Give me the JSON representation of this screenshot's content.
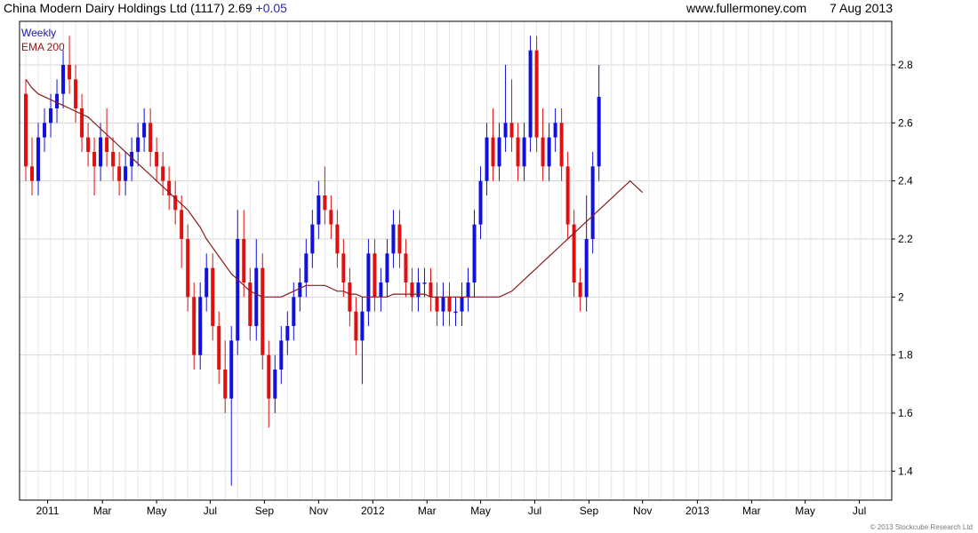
{
  "header": {
    "title": "China Modern Dairy Holdings Ltd (1117)",
    "price": "2.69",
    "change": "+0.05",
    "website": "www.fullermoney.com",
    "date": "7 Aug 2013"
  },
  "legend": {
    "period": "Weekly",
    "ema": "EMA 200"
  },
  "copyright": "© 2013 Stockcube Research Ltd",
  "colors": {
    "up": "#1010e0",
    "down": "#e01010",
    "ema": "#8b1a1a",
    "grid": "#d4d4d4",
    "period_text": "#1a1aaa"
  },
  "chart_data": {
    "type": "candlestick",
    "frequency": "weekly",
    "y_axis": {
      "min": 1.3,
      "max": 2.95,
      "ticks": [
        1.4,
        1.6,
        1.8,
        2,
        2.2,
        2.4,
        2.6,
        2.8
      ],
      "tick_labels": [
        "1.4",
        "1.6",
        "1.8",
        "2",
        "2.2",
        "2.4",
        "2.6",
        "2.8"
      ],
      "position": "right"
    },
    "x_axis": {
      "week_range": [
        -1,
        139
      ],
      "tick_labels": [
        "2011",
        "Mar",
        "May",
        "Jul",
        "Sep",
        "Nov",
        "2012",
        "Mar",
        "May",
        "Jul",
        "Sep",
        "Nov",
        "2013",
        "Mar",
        "May",
        "Jul"
      ],
      "tick_weeks": [
        3.5,
        12.3,
        21,
        29.6,
        38.3,
        47,
        55.7,
        64.4,
        73,
        81.7,
        90.4,
        99,
        107.8,
        116.5,
        125.1,
        133.8
      ]
    },
    "grid": true,
    "legend_position": "top-left",
    "candles": [
      [
        2.7,
        2.75,
        2.4,
        2.45
      ],
      [
        2.45,
        2.55,
        2.35,
        2.4
      ],
      [
        2.4,
        2.6,
        2.35,
        2.55
      ],
      [
        2.55,
        2.65,
        2.5,
        2.6
      ],
      [
        2.6,
        2.7,
        2.55,
        2.65
      ],
      [
        2.65,
        2.75,
        2.6,
        2.7
      ],
      [
        2.7,
        2.85,
        2.65,
        2.8
      ],
      [
        2.8,
        2.9,
        2.7,
        2.75
      ],
      [
        2.75,
        2.8,
        2.6,
        2.65
      ],
      [
        2.65,
        2.7,
        2.5,
        2.55
      ],
      [
        2.55,
        2.6,
        2.45,
        2.5
      ],
      [
        2.5,
        2.55,
        2.35,
        2.45
      ],
      [
        2.45,
        2.6,
        2.4,
        2.55
      ],
      [
        2.55,
        2.65,
        2.45,
        2.5
      ],
      [
        2.5,
        2.55,
        2.4,
        2.45
      ],
      [
        2.45,
        2.5,
        2.35,
        2.4
      ],
      [
        2.4,
        2.5,
        2.35,
        2.45
      ],
      [
        2.45,
        2.55,
        2.4,
        2.5
      ],
      [
        2.5,
        2.6,
        2.45,
        2.55
      ],
      [
        2.55,
        2.65,
        2.5,
        2.6
      ],
      [
        2.6,
        2.65,
        2.45,
        2.5
      ],
      [
        2.5,
        2.55,
        2.4,
        2.45
      ],
      [
        2.45,
        2.5,
        2.35,
        2.4
      ],
      [
        2.4,
        2.45,
        2.3,
        2.35
      ],
      [
        2.35,
        2.4,
        2.25,
        2.3
      ],
      [
        2.3,
        2.35,
        2.1,
        2.2
      ],
      [
        2.2,
        2.25,
        1.95,
        2.0
      ],
      [
        2.0,
        2.05,
        1.75,
        1.8
      ],
      [
        1.8,
        2.05,
        1.75,
        2.0
      ],
      [
        2.0,
        2.15,
        1.95,
        2.1
      ],
      [
        2.1,
        2.15,
        1.85,
        1.9
      ],
      [
        1.9,
        1.95,
        1.7,
        1.75
      ],
      [
        1.75,
        1.85,
        1.6,
        1.65
      ],
      [
        1.65,
        1.9,
        1.35,
        1.85
      ],
      [
        1.85,
        2.3,
        1.8,
        2.2
      ],
      [
        2.2,
        2.3,
        2.0,
        2.05
      ],
      [
        2.05,
        2.1,
        1.85,
        1.9
      ],
      [
        1.9,
        2.2,
        1.85,
        2.1
      ],
      [
        2.1,
        2.15,
        1.75,
        1.8
      ],
      [
        1.8,
        1.85,
        1.55,
        1.65
      ],
      [
        1.65,
        1.8,
        1.6,
        1.75
      ],
      [
        1.75,
        1.9,
        1.7,
        1.85
      ],
      [
        1.85,
        1.95,
        1.8,
        1.9
      ],
      [
        1.9,
        2.05,
        1.85,
        2.0
      ],
      [
        2.0,
        2.1,
        1.95,
        2.05
      ],
      [
        2.05,
        2.2,
        2.0,
        2.15
      ],
      [
        2.15,
        2.3,
        2.1,
        2.25
      ],
      [
        2.25,
        2.4,
        2.2,
        2.35
      ],
      [
        2.35,
        2.45,
        2.25,
        2.3
      ],
      [
        2.3,
        2.35,
        2.2,
        2.25
      ],
      [
        2.25,
        2.3,
        2.1,
        2.15
      ],
      [
        2.15,
        2.2,
        2.0,
        2.05
      ],
      [
        2.05,
        2.1,
        1.9,
        1.95
      ],
      [
        1.95,
        2.0,
        1.8,
        1.85
      ],
      [
        1.85,
        2.0,
        1.7,
        1.95
      ],
      [
        1.95,
        2.2,
        1.9,
        2.15
      ],
      [
        2.15,
        2.2,
        1.95,
        2.0
      ],
      [
        2.0,
        2.1,
        1.95,
        2.05
      ],
      [
        2.05,
        2.2,
        2.0,
        2.15
      ],
      [
        2.15,
        2.3,
        2.1,
        2.25
      ],
      [
        2.25,
        2.3,
        2.1,
        2.15
      ],
      [
        2.15,
        2.2,
        2.0,
        2.05
      ],
      [
        2.05,
        2.1,
        1.95,
        2.0
      ],
      [
        2.0,
        2.1,
        1.95,
        2.05
      ],
      [
        2.05,
        2.1,
        2.0,
        2.05
      ],
      [
        2.05,
        2.1,
        1.95,
        2.0
      ],
      [
        2.0,
        2.05,
        1.9,
        1.95
      ],
      [
        1.95,
        2.05,
        1.9,
        2.0
      ],
      [
        2.0,
        2.05,
        1.9,
        1.95
      ],
      [
        1.95,
        2.0,
        1.9,
        1.95
      ],
      [
        1.95,
        2.05,
        1.9,
        2.0
      ],
      [
        2.0,
        2.1,
        1.95,
        2.05
      ],
      [
        2.05,
        2.3,
        2.0,
        2.25
      ],
      [
        2.25,
        2.45,
        2.2,
        2.4
      ],
      [
        2.4,
        2.6,
        2.35,
        2.55
      ],
      [
        2.55,
        2.65,
        2.4,
        2.45
      ],
      [
        2.45,
        2.6,
        2.4,
        2.55
      ],
      [
        2.55,
        2.8,
        2.5,
        2.6
      ],
      [
        2.6,
        2.75,
        2.5,
        2.55
      ],
      [
        2.55,
        2.6,
        2.4,
        2.45
      ],
      [
        2.45,
        2.6,
        2.4,
        2.55
      ],
      [
        2.55,
        2.9,
        2.5,
        2.85
      ],
      [
        2.85,
        2.9,
        2.5,
        2.55
      ],
      [
        2.55,
        2.65,
        2.4,
        2.45
      ],
      [
        2.45,
        2.6,
        2.4,
        2.55
      ],
      [
        2.55,
        2.65,
        2.5,
        2.6
      ],
      [
        2.6,
        2.65,
        2.4,
        2.45
      ],
      [
        2.45,
        2.5,
        2.2,
        2.25
      ],
      [
        2.25,
        2.3,
        2.0,
        2.05
      ],
      [
        2.05,
        2.1,
        1.95,
        2.0
      ],
      [
        2.0,
        2.35,
        1.95,
        2.2
      ],
      [
        2.2,
        2.5,
        2.15,
        2.45
      ],
      [
        2.45,
        2.8,
        2.4,
        2.69
      ]
    ],
    "ema_200": [
      2.75,
      2.72,
      2.7,
      2.69,
      2.68,
      2.67,
      2.66,
      2.65,
      2.64,
      2.63,
      2.62,
      2.6,
      2.58,
      2.56,
      2.54,
      2.52,
      2.5,
      2.48,
      2.46,
      2.44,
      2.42,
      2.4,
      2.38,
      2.36,
      2.34,
      2.32,
      2.3,
      2.27,
      2.24,
      2.2,
      2.17,
      2.14,
      2.11,
      2.08,
      2.06,
      2.04,
      2.02,
      2.01,
      2.0,
      2.0,
      2.0,
      2.0,
      2.01,
      2.02,
      2.03,
      2.04,
      2.04,
      2.04,
      2.04,
      2.03,
      2.02,
      2.02,
      2.01,
      2.01,
      2.0,
      2.0,
      2.0,
      2.0,
      2.0,
      2.01,
      2.01,
      2.01,
      2.01,
      2.01,
      2.01,
      2.0,
      2.0,
      2.0,
      2.0,
      2.0,
      2.0,
      2.0,
      2.0,
      2.0,
      2.0,
      2.0,
      2.0,
      2.01,
      2.02,
      2.04,
      2.06,
      2.08,
      2.1,
      2.12,
      2.14,
      2.16,
      2.18,
      2.2,
      2.22,
      2.24,
      2.26,
      2.28,
      2.3,
      2.32,
      2.34,
      2.36,
      2.38,
      2.4,
      2.38,
      2.36
    ]
  }
}
